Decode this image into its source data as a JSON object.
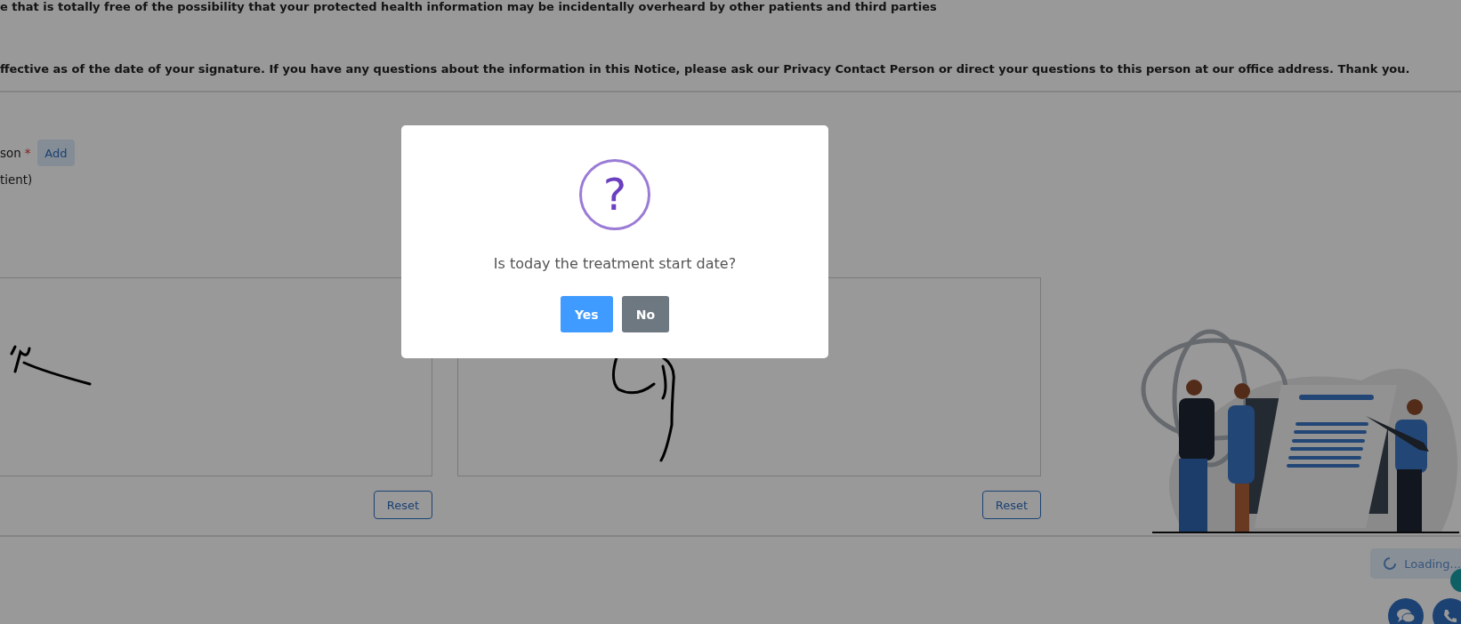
{
  "notice": {
    "lines": [
      "e that is totally free of the possibility that your protected health information may be incidentally overheard by other patients and third parties",
      "ffective as of the date of your signature. If you have any questions about the information in this Notice, please ask our Privacy Contact Person or direct your questions to this person at our office address. Thank you."
    ]
  },
  "form": {
    "field_label": "son",
    "required": true,
    "required_mark": "*",
    "add_button": "Add",
    "sub_label": "tient)"
  },
  "signature_pads": [
    {
      "reset_button": "Reset"
    },
    {
      "reset_button": "Reset"
    }
  ],
  "loading": {
    "text": "Loading..."
  },
  "dialog": {
    "icon": "?",
    "message": "Is today the treatment start date?",
    "buttons": [
      {
        "label": "Yes",
        "kind": "confirm"
      },
      {
        "label": "No",
        "kind": "cancel"
      }
    ]
  }
}
